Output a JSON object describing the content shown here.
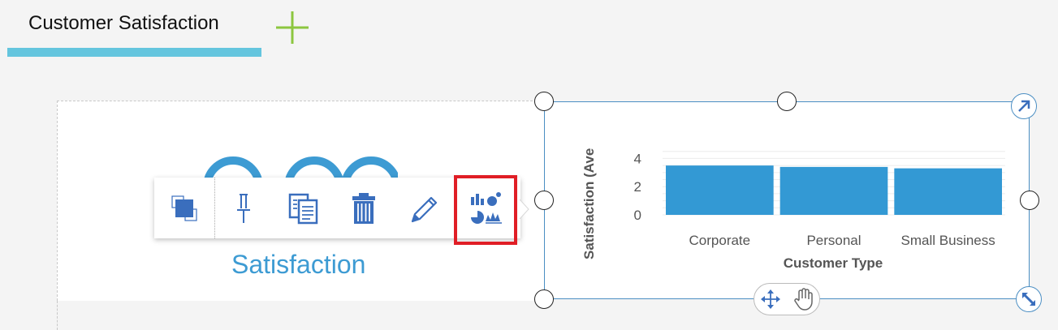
{
  "tabs": [
    {
      "label": "Customer Satisfaction"
    }
  ],
  "add_tab_icon": "plus-icon",
  "colors": {
    "tab_underline": "#64c5de",
    "add_icon": "#8cc63f",
    "accent_blue": "#3d9bd3",
    "bar": "#3399d4",
    "highlight": "#e01e26",
    "widget_border": "#4b8ec3"
  },
  "left_widget": {
    "label": "Satisfaction"
  },
  "toolbar": {
    "items": [
      {
        "icon": "bring-to-front-icon"
      },
      {
        "icon": "pin-icon"
      },
      {
        "icon": "duplicate-icon"
      },
      {
        "icon": "delete-icon"
      },
      {
        "icon": "edit-icon"
      },
      {
        "icon": "change-visualization-icon",
        "highlighted": true
      }
    ]
  },
  "widget_controls": {
    "expand_icon": "expand-arrow-icon",
    "resize_icon": "resize-arrow-icon",
    "move_icon": "move-icon",
    "pan_icon": "hand-icon"
  },
  "chart_data": {
    "type": "bar",
    "categories": [
      "Corporate",
      "Personal",
      "Small Business"
    ],
    "values": [
      3.5,
      3.4,
      3.3
    ],
    "xlabel": "Customer Type",
    "ylabel": "Satisfaction (Ave",
    "yticks": [
      "4",
      "2",
      "0"
    ],
    "ylim": [
      0,
      4.6
    ],
    "grid": true,
    "legend": "none"
  }
}
